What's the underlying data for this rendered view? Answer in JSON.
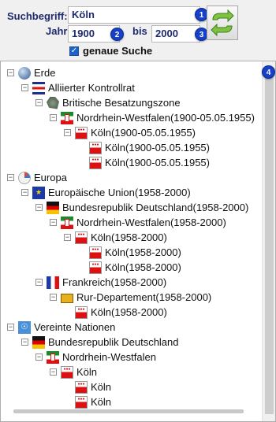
{
  "search": {
    "label": "Suchbegriff:",
    "value": "Köln",
    "year_label": "Jahr",
    "year_from": "1900",
    "between_label": "bis",
    "year_to": "2000",
    "exact_label": "genaue Suche",
    "exact_checked": true
  },
  "badges": [
    "1",
    "2",
    "3",
    "4"
  ],
  "tree": [
    {
      "label": "Erde",
      "icon": "globe-icon",
      "toggle": "−"
    },
    {
      "label": "Alliierter Kontrollrat",
      "icon": "allied-control-council-flag-icon",
      "toggle": "−"
    },
    {
      "label": "Britische Besatzungszone",
      "icon": "british-zone-map-icon",
      "toggle": "−"
    },
    {
      "label": "Nordrhein-Westfalen(1900-05.05.1955)",
      "icon": "nrw-flag-icon",
      "toggle": "−"
    },
    {
      "label": "Köln(1900-05.05.1955)",
      "icon": "koln-coat-of-arms-icon",
      "toggle": "−"
    },
    {
      "label": "Köln(1900-05.05.1955)",
      "icon": "koln-coat-of-arms-icon",
      "toggle": ""
    },
    {
      "label": "Köln(1900-05.05.1955)",
      "icon": "koln-coat-of-arms-icon",
      "toggle": ""
    },
    {
      "label": "Europa",
      "icon": "europe-pie-icon",
      "toggle": "−"
    },
    {
      "label": "Europäische Union(1958-2000)",
      "icon": "eu-flag-icon",
      "toggle": "−"
    },
    {
      "label": "Bundesrepublik Deutschland(1958-2000)",
      "icon": "german-flag-icon",
      "toggle": "−"
    },
    {
      "label": "Nordrhein-Westfalen(1958-2000)",
      "icon": "nrw-flag-icon",
      "toggle": "−"
    },
    {
      "label": "Köln(1958-2000)",
      "icon": "koln-coat-of-arms-icon",
      "toggle": "−"
    },
    {
      "label": "Köln(1958-2000)",
      "icon": "koln-coat-of-arms-icon",
      "toggle": ""
    },
    {
      "label": "Köln(1958-2000)",
      "icon": "koln-coat-of-arms-icon",
      "toggle": ""
    },
    {
      "label": "Frankreich(1958-2000)",
      "icon": "french-flag-icon",
      "toggle": "−"
    },
    {
      "label": "Rur-Departement(1958-2000)",
      "icon": "rur-departement-icon",
      "toggle": "−"
    },
    {
      "label": "Köln(1958-2000)",
      "icon": "koln-coat-of-arms-icon",
      "toggle": ""
    },
    {
      "label": "Vereinte Nationen",
      "icon": "un-flag-icon",
      "toggle": "−"
    },
    {
      "label": "Bundesrepublik Deutschland",
      "icon": "german-flag-icon",
      "toggle": "−"
    },
    {
      "label": "Nordrhein-Westfalen",
      "icon": "nrw-flag-icon",
      "toggle": "−"
    },
    {
      "label": "Köln",
      "icon": "koln-coat-of-arms-icon",
      "toggle": "−"
    },
    {
      "label": "Köln",
      "icon": "koln-coat-of-arms-icon",
      "toggle": ""
    },
    {
      "label": "Köln",
      "icon": "koln-coat-of-arms-icon",
      "toggle": ""
    }
  ]
}
